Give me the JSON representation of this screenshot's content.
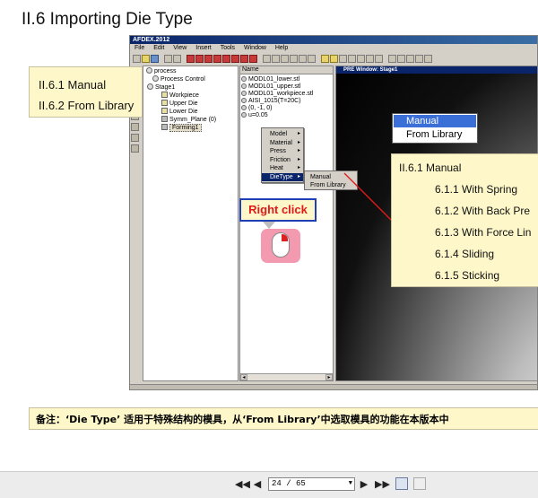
{
  "slide": {
    "title": "II.6 Importing Die Type"
  },
  "app": {
    "window_title": "AFDEX.2012",
    "menu": [
      "File",
      "Edit",
      "View",
      "Insert",
      "Tools",
      "Window",
      "Help"
    ],
    "tree": {
      "root": "process",
      "process_control": "Process Control",
      "stage": "Stage1",
      "workpiece": "Workpiece",
      "upper_die": "Upper Die",
      "lower_die": "Lower Die",
      "symm_plane": "Symm_Plane (0)",
      "forming": "Forming1"
    },
    "file_list": {
      "header": "Name",
      "items": [
        "MODL01_lower.stl",
        "MODL01_upper.stl",
        "MODL01_workpiece.stl",
        "AISI_1015(T=20C)",
        "(0, -1, 0)",
        "u=0.05"
      ]
    },
    "pre_window_title": "PRE Window: Stage1",
    "context_menu": [
      {
        "label": "Model"
      },
      {
        "label": "Material"
      },
      {
        "label": "Press"
      },
      {
        "label": "Friction"
      },
      {
        "label": "Heat"
      },
      {
        "label": "DieType"
      }
    ],
    "submenu": [
      "Manual",
      "From Library"
    ]
  },
  "callout_left": {
    "line1": "II.6.1 Manual",
    "line2": "II.6.2 From Library"
  },
  "right_click_label": "Right click",
  "dropdown": {
    "options": [
      "Manual",
      "From Library"
    ],
    "selected": "Manual"
  },
  "panel_right": {
    "heading": "II.6.1 Manual",
    "items": [
      "6.1.1 With Spring",
      "6.1.2 With Back Pre",
      "6.1.3 With Force Lin",
      "6.1.4 Sliding",
      "6.1.5 Sticking"
    ]
  },
  "note": "备注：‘Die Type’ 适用于特殊结构的模具，从‘From Library’中选取模具的功能在本版本中",
  "navigation": {
    "page_text": "24 / 65",
    "first_label": "◀◀",
    "prev_label": "◀",
    "next_label": "▶",
    "last_label": "▶▶"
  },
  "colors": {
    "callout_bg": "#fdf7c9",
    "label_red": "#e21a1a",
    "label_border": "#1f3fb5",
    "selection_blue": "#3a6fd8"
  }
}
